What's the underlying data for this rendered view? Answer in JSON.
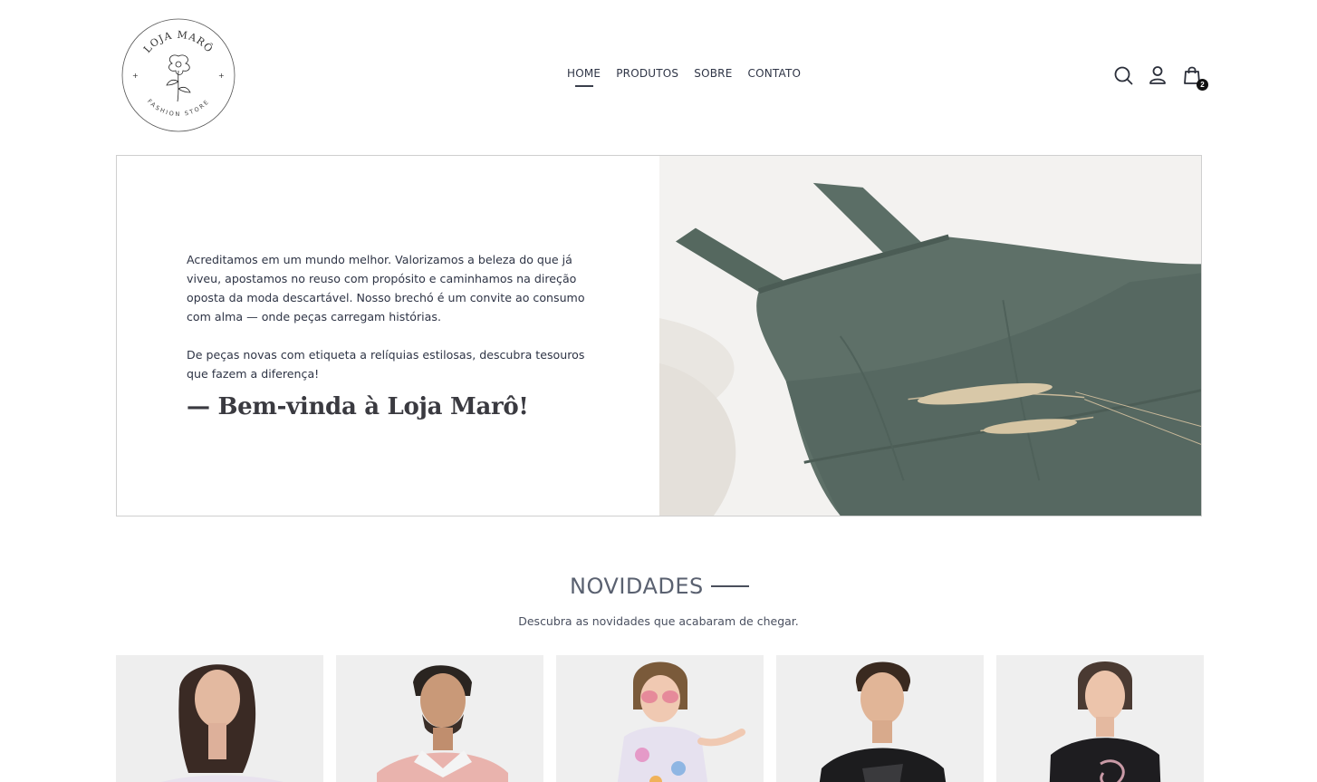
{
  "brand": {
    "logo_top_text": "LOJA MARÔ",
    "logo_bottom_text": "FASHION STORE"
  },
  "nav": {
    "items": [
      {
        "label": "HOME",
        "active": true
      },
      {
        "label": "PRODUTOS",
        "active": false
      },
      {
        "label": "SOBRE",
        "active": false
      },
      {
        "label": "CONTATO",
        "active": false
      }
    ]
  },
  "header_icons": {
    "search": "search-icon",
    "account": "user-icon",
    "cart": "shopping-bag-icon",
    "cart_count": "2"
  },
  "hero": {
    "paragraph_1": "Acreditamos em um mundo melhor. Valorizamos a beleza do que já viveu, apostamos no reuso com propósito e caminhamos na direção oposta da moda descartável. Nosso brechó é um convite ao consumo com alma — onde peças carregam histórias.",
    "paragraph_2": "De peças novas com etiqueta a relíquias estilosas, descubra tesouros que fazem a diferença!",
    "welcome": "— Bem-vinda à Loja Marô!"
  },
  "novidades": {
    "title": "NOVIDADES",
    "subtitle": "Descubra as novidades que acabaram de chegar."
  },
  "colors": {
    "dress": "#5e7068",
    "text": "#2e3445",
    "card_bg": "#eeeeee"
  }
}
